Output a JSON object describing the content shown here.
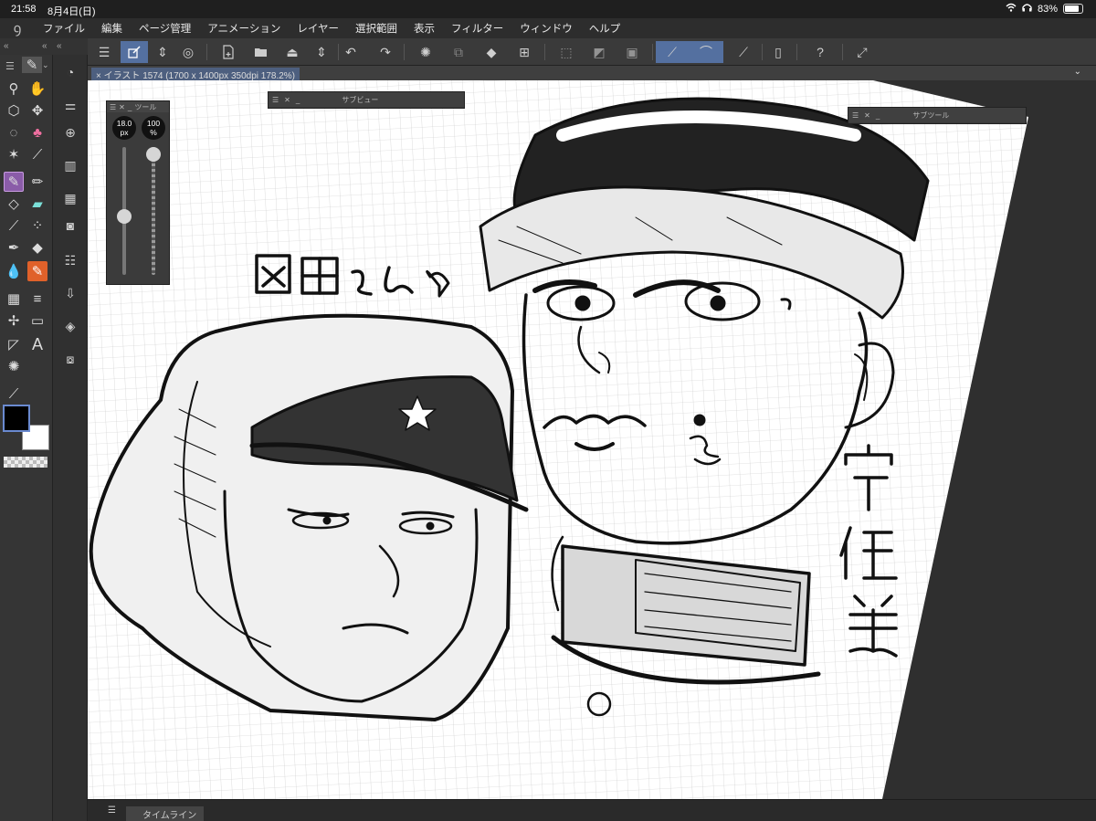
{
  "status_bar": {
    "time": "21:58",
    "date": "8月4日(日)",
    "battery": "83%",
    "battery_level": 0.83
  },
  "menu": {
    "items": [
      "ファイル",
      "編集",
      "ページ管理",
      "アニメーション",
      "レイヤー",
      "選択範囲",
      "表示",
      "フィルター",
      "ウィンドウ",
      "ヘルプ"
    ]
  },
  "canvas": {
    "tab_title": "イラスト 1574 (1700 x 1400px 350dpi 178.2%)",
    "close_glyph": "×"
  },
  "panels": {
    "subview_title": "サブビュー",
    "subtool_title": "サブツール",
    "tool_property_title": "ツール"
  },
  "brush": {
    "size_value": "18.0",
    "size_unit": "px",
    "opacity_value": "100",
    "opacity_unit": "%",
    "size_level": 0.45,
    "opacity_level": 1.0
  },
  "timeline": {
    "label": "タイムライン"
  },
  "colors": {
    "main": "#000000",
    "sub": "#ffffff",
    "accent": "#5470a0",
    "selected_tool": "#8a5ca8"
  },
  "artwork": {
    "text_okada": "岡田さん♡",
    "text_usami": "宇佐美"
  }
}
